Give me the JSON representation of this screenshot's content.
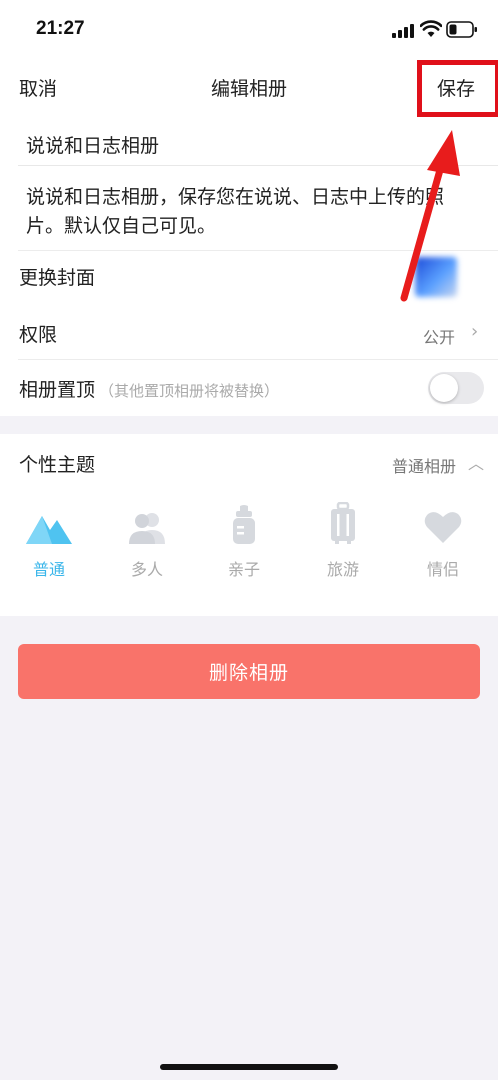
{
  "status_bar": {
    "time": "21:27"
  },
  "nav": {
    "cancel_label": "取消",
    "title": "编辑相册",
    "save_label": "保存"
  },
  "album": {
    "name": "说说和日志相册",
    "description": "说说和日志相册，保存您在说说、日志中上传的照片。默认仅自己可见。"
  },
  "settings": {
    "cover_label": "更换封面",
    "permission_label": "权限",
    "permission_value": "公开",
    "pin_label": "相册置顶",
    "pin_hint": "（其他置顶相册将被替换）",
    "pin_enabled": false
  },
  "theme": {
    "label": "个性主题",
    "value": "普通相册",
    "items": [
      {
        "label": "普通",
        "icon": "mountain-icon",
        "active": true
      },
      {
        "label": "多人",
        "icon": "people-icon",
        "active": false
      },
      {
        "label": "亲子",
        "icon": "baby-bottle-icon",
        "active": false
      },
      {
        "label": "旅游",
        "icon": "suitcase-icon",
        "active": false
      },
      {
        "label": "情侣",
        "icon": "heart-icon",
        "active": false
      }
    ]
  },
  "delete_label": "删除相册",
  "colors": {
    "accent": "#3bb6ea",
    "delete": "#f9736a",
    "highlight": "#e0101a"
  }
}
